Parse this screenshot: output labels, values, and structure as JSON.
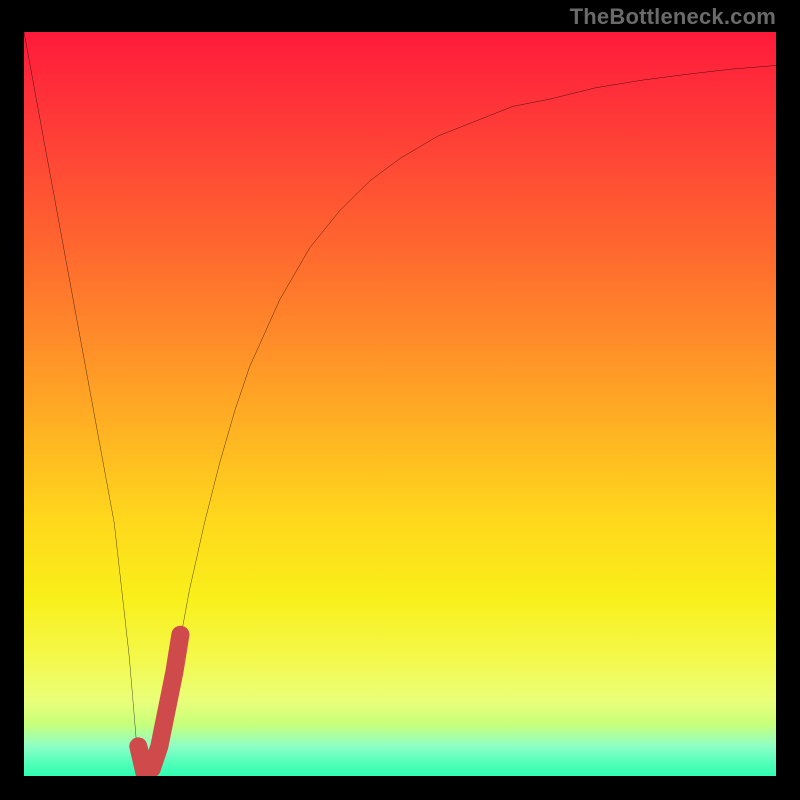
{
  "watermark": "TheBottleneck.com",
  "chart_data": {
    "type": "line",
    "title": "",
    "xlabel": "",
    "ylabel": "",
    "xlim": [
      0,
      100
    ],
    "ylim": [
      0,
      100
    ],
    "series": [
      {
        "name": "bottleneck-curve",
        "color": "#000000",
        "x": [
          0,
          2,
          4,
          6,
          8,
          10,
          12,
          14,
          15,
          16,
          17,
          18,
          20,
          22,
          24,
          26,
          28,
          30,
          34,
          38,
          42,
          46,
          50,
          55,
          60,
          65,
          70,
          76,
          82,
          88,
          94,
          100
        ],
        "y": [
          100,
          89,
          78,
          67,
          56,
          45,
          34,
          16,
          4,
          0,
          1,
          4,
          14,
          25,
          34,
          42,
          49,
          55,
          64,
          71,
          76,
          80,
          83,
          86,
          88,
          90,
          91,
          92.5,
          93.5,
          94.3,
          95,
          95.5
        ]
      },
      {
        "name": "highlighted-segment",
        "color": "#d14a4a",
        "x": [
          15.2,
          16.0,
          17.0,
          18.0,
          19.0,
          20.0,
          20.8
        ],
        "y": [
          4.0,
          0.5,
          1.0,
          4.0,
          9.0,
          14.0,
          19.0
        ]
      }
    ],
    "gradient_stops": [
      {
        "pct": 0,
        "color": "#ff1a3a"
      },
      {
        "pct": 50,
        "color": "#ffb422"
      },
      {
        "pct": 80,
        "color": "#f4f84a"
      },
      {
        "pct": 100,
        "color": "#2fffaf"
      }
    ]
  }
}
